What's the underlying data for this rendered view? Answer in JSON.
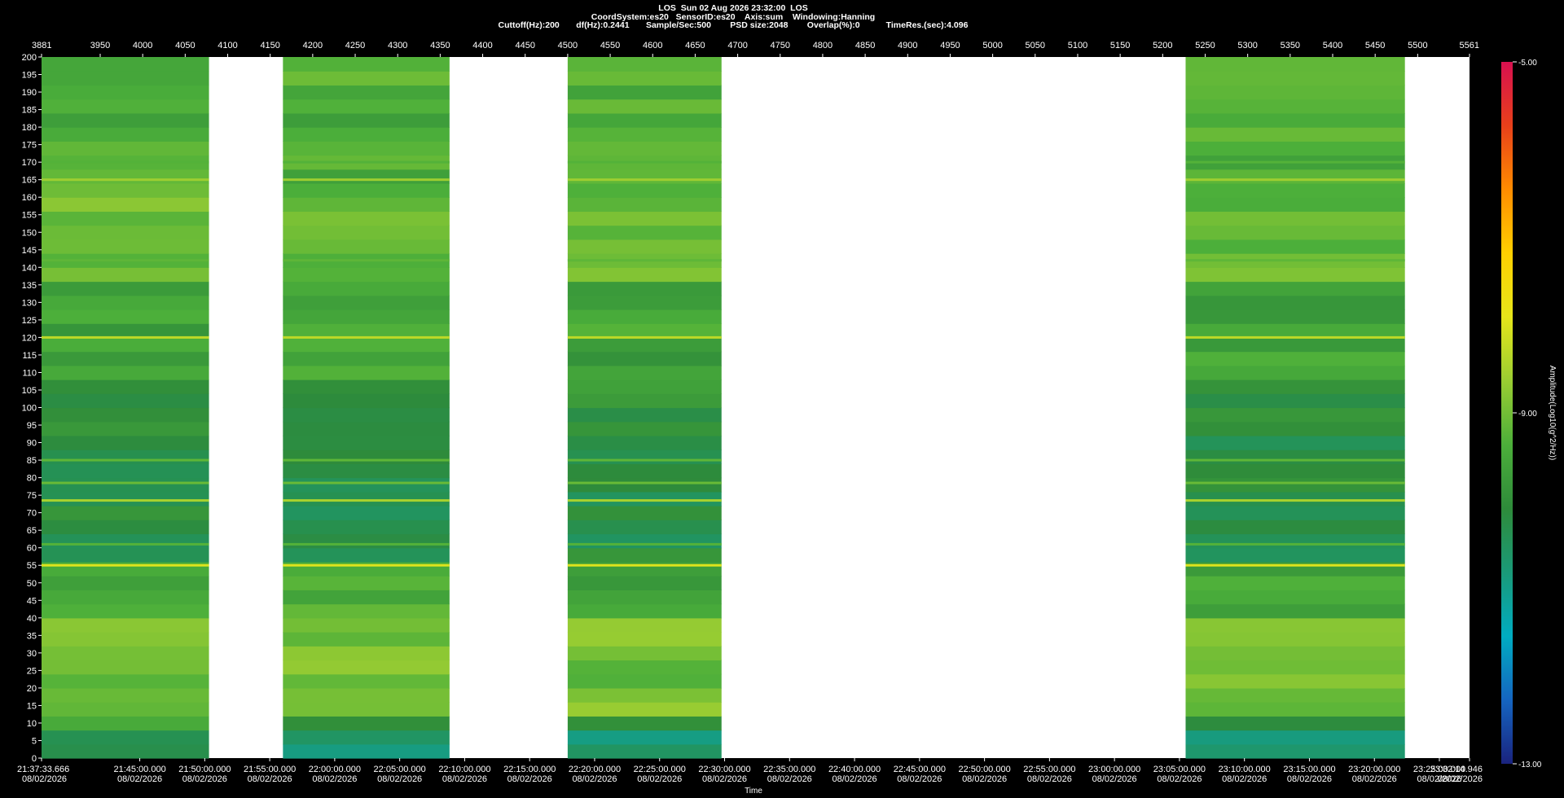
{
  "header": {
    "line1": "LOS  Sun 02 Aug 2026 23:32:00  LOS",
    "line2": "CoordSystem:es20   SensorID:es20    Axis:sum    Windowing:Hanning",
    "line3": "Cuttoff(Hz):200       df(Hz):0.2441       Sample/Sec:500        PSD size:2048        Overlap(%):0           TimeRes.(sec):4.096"
  },
  "colors": {
    "background": "#000000",
    "plot_background": "#ffffff",
    "colormap": [
      "#1a237e",
      "#1565c0",
      "#00acc1",
      "#1a9a78",
      "#2e8b3a",
      "#4caf3a",
      "#9acd32",
      "#e6e61a",
      "#ffd000",
      "#ff8c00",
      "#e8401a",
      "#d81050"
    ]
  },
  "chart_data": {
    "type": "heatmap",
    "title": "LOS  Sun 02 Aug 2026 23:32:00  LOS",
    "xlabel": "Time",
    "ylabel": "",
    "colorbar_label": "Amplitude(Log10(g^2/Hz))",
    "top_axis": {
      "range": [
        3881,
        5561
      ],
      "ticks": [
        "3881",
        "3950",
        "4000",
        "4050",
        "4100",
        "4150",
        "4200",
        "4250",
        "4300",
        "4350",
        "4400",
        "4450",
        "4500",
        "4550",
        "4600",
        "4650",
        "4700",
        "4750",
        "4800",
        "4850",
        "4900",
        "4950",
        "5000",
        "5050",
        "5100",
        "5150",
        "5200",
        "5250",
        "5300",
        "5350",
        "5400",
        "5450",
        "5500",
        "5561"
      ]
    },
    "y_axis": {
      "range": [
        0,
        200
      ],
      "ticks": [
        "0",
        "5",
        "10",
        "15",
        "20",
        "25",
        "30",
        "35",
        "40",
        "45",
        "50",
        "55",
        "60",
        "65",
        "70",
        "75",
        "80",
        "85",
        "90",
        "95",
        "100",
        "105",
        "110",
        "115",
        "120",
        "125",
        "130",
        "135",
        "140",
        "145",
        "150",
        "155",
        "160",
        "165",
        "170",
        "175",
        "180",
        "185",
        "190",
        "195",
        "200"
      ],
      "grid": false
    },
    "x_axis": {
      "ticks": [
        {
          "time": "21:37:33.666",
          "date": "08/02/2026"
        },
        {
          "time": "21:45:00.000",
          "date": "08/02/2026"
        },
        {
          "time": "21:50:00.000",
          "date": "08/02/2026"
        },
        {
          "time": "21:55:00.000",
          "date": "08/02/2026"
        },
        {
          "time": "22:00:00.000",
          "date": "08/02/2026"
        },
        {
          "time": "22:05:00.000",
          "date": "08/02/2026"
        },
        {
          "time": "22:10:00.000",
          "date": "08/02/2026"
        },
        {
          "time": "22:15:00.000",
          "date": "08/02/2026"
        },
        {
          "time": "22:20:00.000",
          "date": "08/02/2026"
        },
        {
          "time": "22:25:00.000",
          "date": "08/02/2026"
        },
        {
          "time": "22:30:00.000",
          "date": "08/02/2026"
        },
        {
          "time": "22:35:00.000",
          "date": "08/02/2026"
        },
        {
          "time": "22:40:00.000",
          "date": "08/02/2026"
        },
        {
          "time": "22:45:00.000",
          "date": "08/02/2026"
        },
        {
          "time": "22:50:00.000",
          "date": "08/02/2026"
        },
        {
          "time": "22:55:00.000",
          "date": "08/02/2026"
        },
        {
          "time": "23:00:00.000",
          "date": "08/02/2026"
        },
        {
          "time": "23:05:00.000",
          "date": "08/02/2026"
        },
        {
          "time": "23:10:00.000",
          "date": "08/02/2026"
        },
        {
          "time": "23:15:00.000",
          "date": "08/02/2026"
        },
        {
          "time": "23:20:00.000",
          "date": "08/02/2026"
        },
        {
          "time": "23:25:00.000",
          "date": "08/02/2026"
        },
        {
          "time": "23:32:14.946",
          "date": "08/02/2026"
        }
      ]
    },
    "colorbar": {
      "range": [
        -13.0,
        -5.0
      ],
      "ticks": [
        "-5.00",
        "-9.00",
        "-13.00"
      ]
    },
    "data_segments": [
      {
        "start": 3881,
        "end": 4078
      },
      {
        "start": 4165,
        "end": 4361
      },
      {
        "start": 4500,
        "end": 4681
      },
      {
        "start": 5227,
        "end": 5485
      }
    ],
    "spectral_lines_hz": [
      {
        "freq": 85,
        "level": -9.2
      },
      {
        "freq": 78.5,
        "level": -9.1
      },
      {
        "freq": 73.5,
        "level": -8.5
      },
      {
        "freq": 61,
        "level": -9.3
      },
      {
        "freq": 55,
        "level": -8.0
      },
      {
        "freq": 120,
        "level": -8.3
      },
      {
        "freq": 165,
        "level": -8.6
      },
      {
        "freq": 170,
        "level": -9.3
      },
      {
        "freq": 142,
        "level": -9.2
      }
    ]
  }
}
